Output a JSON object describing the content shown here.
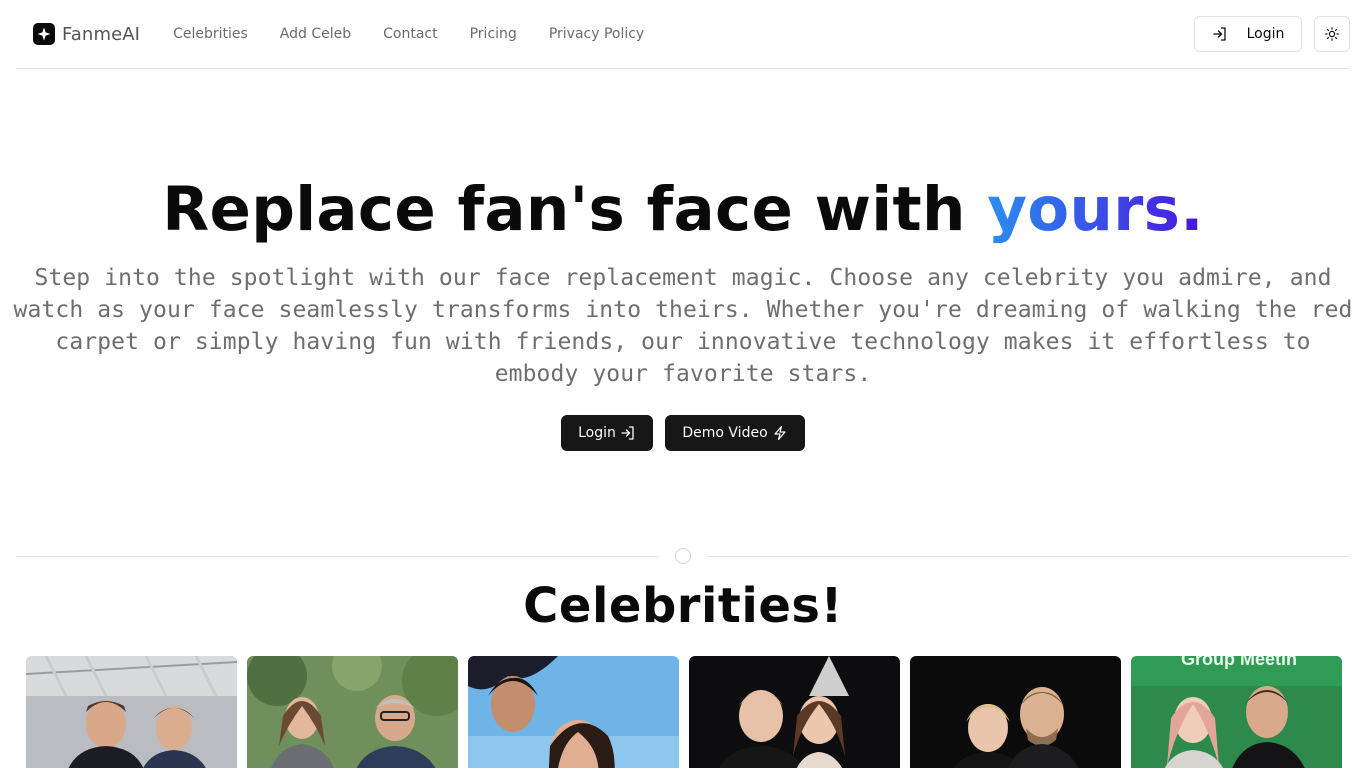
{
  "brand": {
    "name": "FanmeAI"
  },
  "nav": {
    "links": [
      "Celebrities",
      "Add Celeb",
      "Contact",
      "Pricing",
      "Privacy Policy"
    ],
    "login_label": "Login"
  },
  "hero": {
    "title_main": "Replace fan's face with ",
    "title_accent": "yours.",
    "description": "Step into the spotlight with our face replacement magic. Choose any celebrity you admire, and watch as your face seamlessly transforms into theirs. Whether you're dreaming of walking the red carpet or simply having fun with friends, our innovative technology makes it effortless to embody your favorite stars.",
    "login_label": "Login",
    "demo_label": "Demo Video"
  },
  "section": {
    "title": "Celebrities!"
  },
  "cards": [
    {
      "name": "celebrity-card-1"
    },
    {
      "name": "celebrity-card-2"
    },
    {
      "name": "celebrity-card-3"
    },
    {
      "name": "celebrity-card-4"
    },
    {
      "name": "celebrity-card-5"
    },
    {
      "name": "celebrity-card-6",
      "banner_text": "Group Meetin"
    }
  ],
  "colors": {
    "accent_start": "#2a8ef0",
    "accent_end": "#4a14e0",
    "button_dark": "#171717"
  }
}
